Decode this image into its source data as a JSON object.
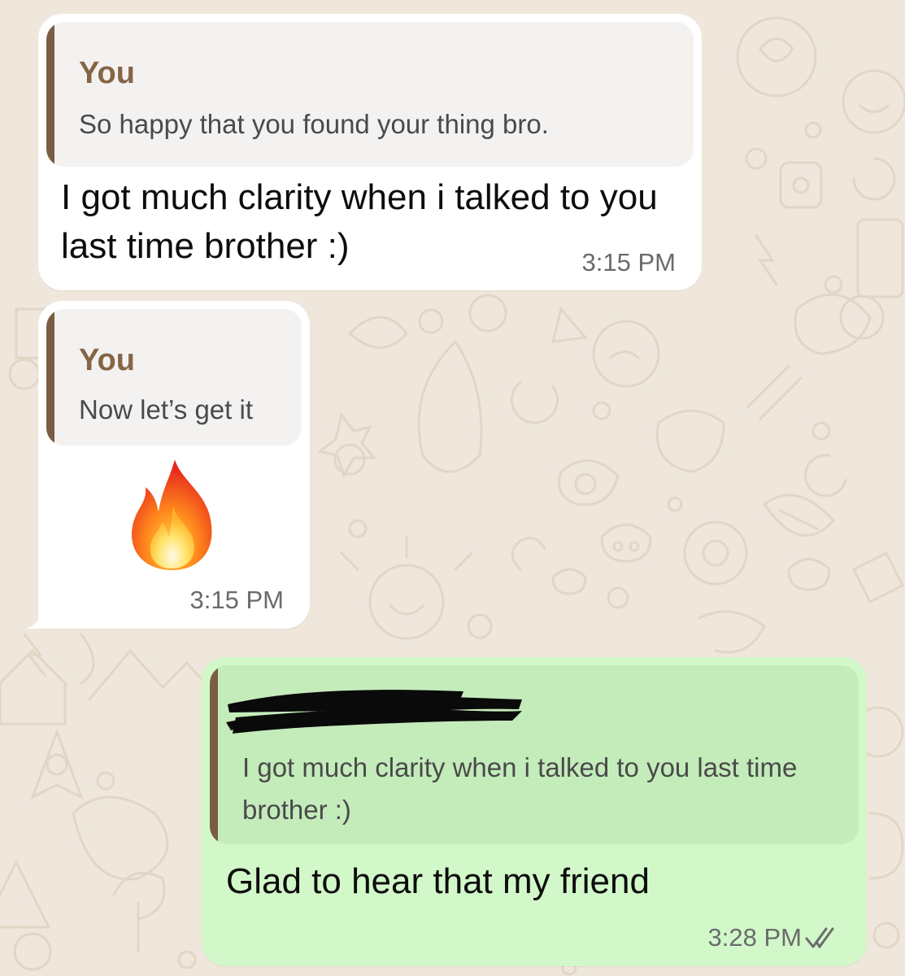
{
  "theme": {
    "wallpaper": "#efe7dc",
    "incoming_bubble": "#ffffff",
    "outgoing_bubble": "#d2f8c9",
    "quote_bar": "#7a5d43"
  },
  "messages": [
    {
      "direction": "incoming",
      "reply": {
        "author": "You",
        "text": "So happy that you found your thing bro."
      },
      "text": "I got much clarity when i talked to you last time brother :)",
      "time": "3:15 PM"
    },
    {
      "direction": "incoming",
      "reply": {
        "author": "You",
        "text": "Now let’s get it"
      },
      "emoji": "fire-emoji",
      "time": "3:15 PM"
    },
    {
      "direction": "outgoing",
      "reply": {
        "author_redacted": true,
        "text": "I got much clarity when i talked to you last time brother :)"
      },
      "text": "Glad to hear that my friend",
      "time": "3:28 PM",
      "status": "read-double-check-icon"
    }
  ]
}
